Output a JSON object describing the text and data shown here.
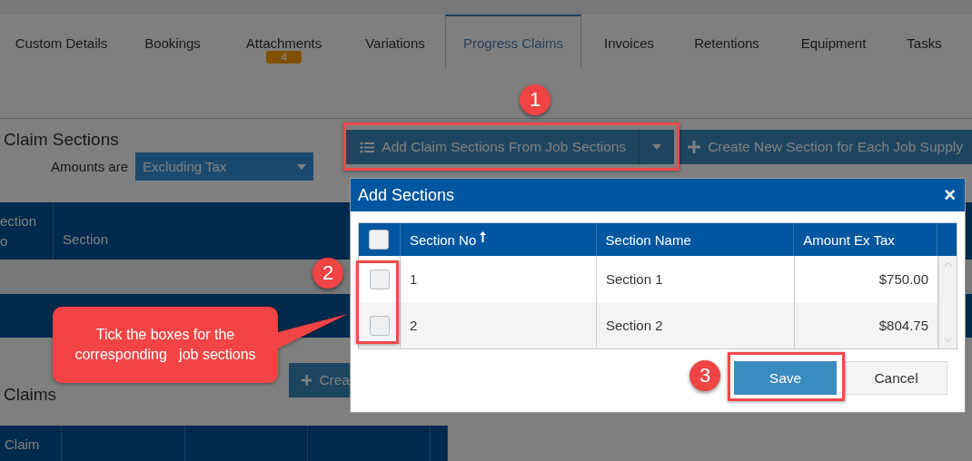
{
  "tabs": [
    {
      "label": "Custom Details",
      "selected": false
    },
    {
      "label": "Bookings",
      "selected": false
    },
    {
      "label": "Attachments",
      "selected": false,
      "badge": "4"
    },
    {
      "label": "Variations",
      "selected": false
    },
    {
      "label": "Progress Claims",
      "selected": true
    },
    {
      "label": "Invoices",
      "selected": false
    },
    {
      "label": "Retentions",
      "selected": false
    },
    {
      "label": "Equipment",
      "selected": false
    },
    {
      "label": "Tasks",
      "selected": false
    }
  ],
  "claim_sections": {
    "title": "Claim Sections",
    "amounts_label": "Amounts are",
    "amounts_select": "Excluding Tax",
    "add_button": "Add Claim Sections From Job Sections",
    "create_button": "Create New Section for Each Job Supply",
    "columns": [
      "ection\no",
      "Section"
    ]
  },
  "claims": {
    "title": "Claims",
    "create_button": "Crea",
    "columns": [
      "Claim"
    ]
  },
  "dialog": {
    "title": "Add Sections",
    "close": "×",
    "select_all_checked": false,
    "columns": [
      {
        "label": "Section No",
        "sorted": true
      },
      {
        "label": "Section Name",
        "sorted": false
      },
      {
        "label": "Amount Ex Tax",
        "sorted": false
      }
    ],
    "rows": [
      {
        "section_no": "1",
        "section_name": "Section 1",
        "amount": "$750.00",
        "checked": false
      },
      {
        "section_no": "2",
        "section_name": "Section 2",
        "amount": "$804.75",
        "checked": false
      }
    ],
    "buttons": [
      {
        "label": "Save",
        "kind": "primary"
      },
      {
        "label": "Cancel",
        "kind": "secondary"
      }
    ]
  },
  "annotations": {
    "steps": [
      "1",
      "2",
      "3"
    ],
    "callout": "Tick the boxes for the corresponding   job sections"
  }
}
